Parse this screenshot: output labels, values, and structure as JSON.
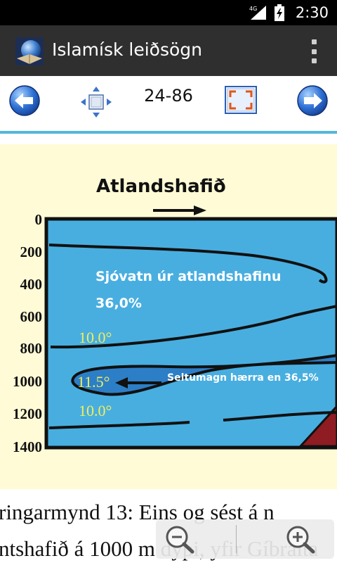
{
  "status_bar": {
    "network": "4G",
    "time": "2:30"
  },
  "action_bar": {
    "title": "Islamísk leiðsögn"
  },
  "toolbar": {
    "page_indicator": "24-86"
  },
  "figure": {
    "title": "Atlandshafið",
    "depth_labels": [
      "0",
      "200",
      "400",
      "600",
      "800",
      "1000",
      "1200",
      "1400"
    ],
    "water_label_line1": "Sjóvatn úr atlandshafinu",
    "water_label_line2": "36,0%",
    "temp_upper": "10.0°",
    "temp_middle": "11.5°",
    "temp_lower": "10.0°",
    "salinity_label": "Seltumagn hærra en 36,5%",
    "colors": {
      "ocean": "#48aee0",
      "tongue": "#2c7fc6",
      "seabed": "#8e1c22",
      "temp_text": "#f2ef5a",
      "background": "#fffbd6"
    }
  },
  "caption": {
    "line1": "ringarmynd 13: Eins og sést á n",
    "line2": "ntshafið á 1000 m dýpi, yfir Gíbralta"
  },
  "icons": [
    "back-arrow-icon",
    "move-icon",
    "fullscreen-icon",
    "forward-arrow-icon",
    "zoom-out-icon",
    "zoom-in-icon"
  ]
}
